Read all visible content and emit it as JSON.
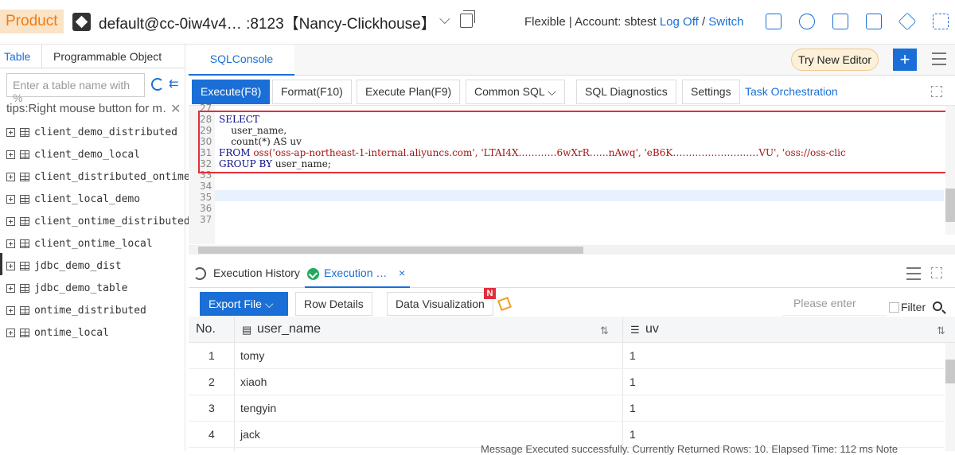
{
  "header": {
    "product_label": "Product",
    "connection_title": "default@cc-0iw4v4… :8123【Nancy-Clickhouse】",
    "mode_account": "Flexible | Account: sbtest",
    "log_off": "Log Off",
    "slash": "/",
    "switch": "Switch",
    "icons": [
      "table-icon",
      "monitor-icon",
      "export-icon",
      "notes-icon",
      "send-icon",
      "fullscreen-icon"
    ]
  },
  "sidebar": {
    "tabs": [
      "Table",
      "Programmable Object"
    ],
    "search_placeholder": "Enter a table name with %",
    "tips": "tips:Right mouse button for m…",
    "tables": [
      "client_demo_distributed",
      "client_demo_local",
      "client_distributed_ontime",
      "client_local_demo",
      "client_ontime_distributed",
      "client_ontime_local",
      "jdbc_demo_dist",
      "jdbc_demo_table",
      "ontime_distributed",
      "ontime_local"
    ]
  },
  "console": {
    "tab_label": "SQLConsole",
    "try_new_editor": "Try New Editor",
    "add_label": "+",
    "toolbar": {
      "execute": "Execute(F8)",
      "format": "Format(F10)",
      "execute_plan": "Execute Plan(F9)",
      "common_sql": "Common SQL",
      "sql_diagnostics": "SQL Diagnostics",
      "settings": "Settings",
      "task_orchestration": "Task Orchestration"
    },
    "editor": {
      "line_numbers": [
        "27",
        "28",
        "29",
        "30",
        "31",
        "32",
        "33",
        "34",
        "35",
        "36",
        "37"
      ],
      "lines": {
        "l27": "SELECT",
        "l28": "    user_name,",
        "l29": "    count(*) AS uv",
        "l30_kw": "FROM",
        "l30_rest": " oss('oss-ap-northeast-1-internal.aliyuncs.com', 'LTAI4X…………6wXrR……nAwq', 'eB6K………………………VU', 'oss://oss-clic",
        "l31_kw": "GROUP BY",
        "l31_rest": " user_name;"
      }
    }
  },
  "results": {
    "tabs": {
      "history": "Execution History",
      "execution": "Execution …",
      "close": "×"
    },
    "toolbar": {
      "export_file": "Export File",
      "row_details": "Row Details",
      "data_visualization": "Data Visualization",
      "badge": "N",
      "filter_placeholder": "Please enter",
      "filter_label": "Filter"
    },
    "columns": [
      "No.",
      "user_name",
      "uv"
    ],
    "rows": [
      {
        "no": "1",
        "user_name": "tomy",
        "uv": "1"
      },
      {
        "no": "2",
        "user_name": "xiaoh",
        "uv": "1"
      },
      {
        "no": "3",
        "user_name": "tengyin",
        "uv": "1"
      },
      {
        "no": "4",
        "user_name": "jack",
        "uv": "1"
      }
    ],
    "status_text": "Message  Executed successfully. Currently Returned Rows: 10. Elapsed Time: 112 ms      Note"
  }
}
